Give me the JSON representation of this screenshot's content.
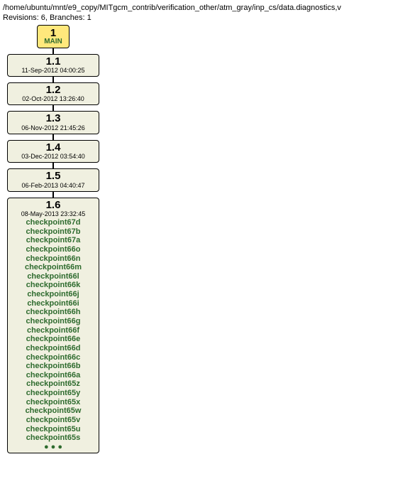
{
  "header": {
    "path": "/home/ubuntu/mnt/e9_copy/MITgcm_contrib/verification_other/atm_gray/inp_cs/data.diagnostics,v",
    "summary": "Revisions: 6, Branches: 1"
  },
  "main": {
    "num": "1",
    "label": "MAIN"
  },
  "revisions": [
    {
      "num": "1.1",
      "date": "11-Sep-2012 04:00:25"
    },
    {
      "num": "1.2",
      "date": "02-Oct-2012 13:26:40"
    },
    {
      "num": "1.3",
      "date": "06-Nov-2012 21:45:26"
    },
    {
      "num": "1.4",
      "date": "03-Dec-2012 03:54:40"
    },
    {
      "num": "1.5",
      "date": "06-Feb-2013 04:40:47"
    }
  ],
  "final": {
    "num": "1.6",
    "date": "08-May-2013 23:32:45",
    "tags": [
      "checkpoint67d",
      "checkpoint67b",
      "checkpoint67a",
      "checkpoint66o",
      "checkpoint66n",
      "checkpoint66m",
      "checkpoint66l",
      "checkpoint66k",
      "checkpoint66j",
      "checkpoint66i",
      "checkpoint66h",
      "checkpoint66g",
      "checkpoint66f",
      "checkpoint66e",
      "checkpoint66d",
      "checkpoint66c",
      "checkpoint66b",
      "checkpoint66a",
      "checkpoint65z",
      "checkpoint65y",
      "checkpoint65x",
      "checkpoint65w",
      "checkpoint65v",
      "checkpoint65u",
      "checkpoint65s"
    ],
    "ellipsis": "● ● ●"
  }
}
